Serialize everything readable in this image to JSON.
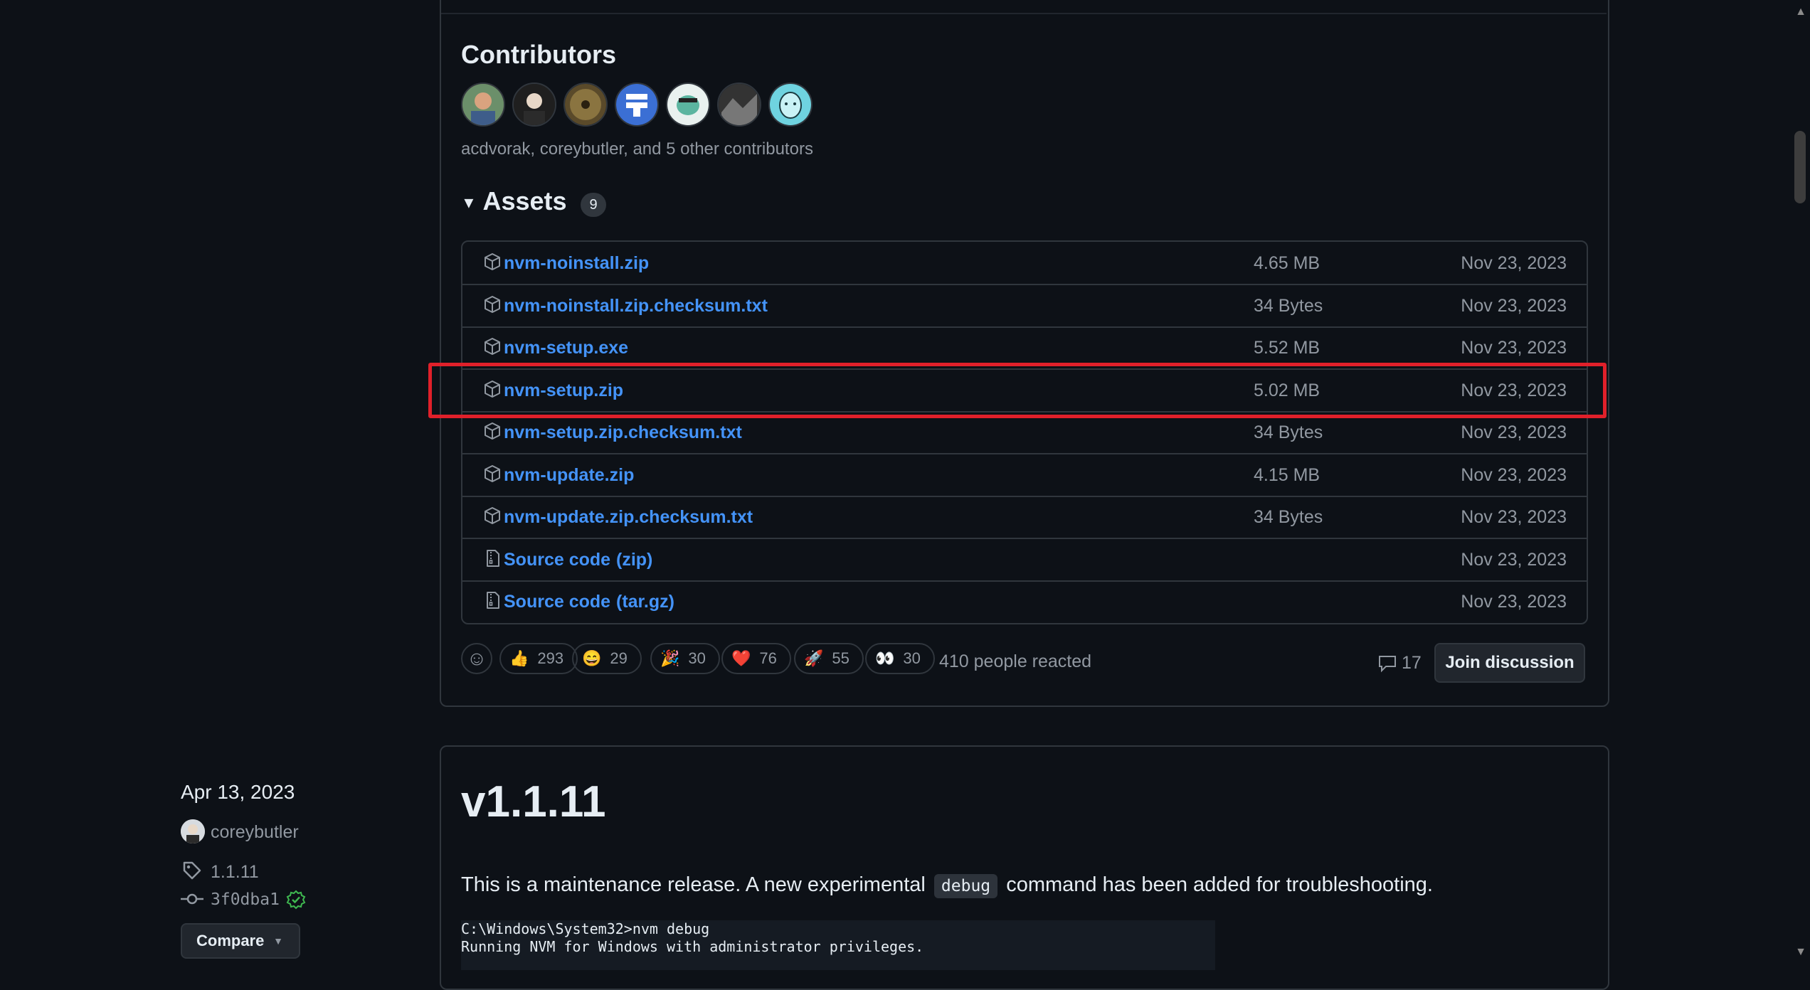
{
  "contributors": {
    "title": "Contributors",
    "summary": "acdvorak, coreybutler, and 5 other contributors",
    "avatars": [
      "avatar-1",
      "avatar-2",
      "avatar-3",
      "avatar-4",
      "avatar-5",
      "avatar-6",
      "avatar-7"
    ]
  },
  "assets": {
    "title": "Assets",
    "count": "9",
    "rows": [
      {
        "name": "nvm-noinstall.zip",
        "sub": "",
        "size": "4.65 MB",
        "date": "Nov 23, 2023",
        "icon": "package-icon"
      },
      {
        "name": "nvm-noinstall.zip.checksum.txt",
        "sub": "",
        "size": "34 Bytes",
        "date": "Nov 23, 2023",
        "icon": "package-icon"
      },
      {
        "name": "nvm-setup.exe",
        "sub": "",
        "size": "5.52 MB",
        "date": "Nov 23, 2023",
        "icon": "package-icon"
      },
      {
        "name": "nvm-setup.zip",
        "sub": "",
        "size": "5.02 MB",
        "date": "Nov 23, 2023",
        "icon": "package-icon"
      },
      {
        "name": "nvm-setup.zip.checksum.txt",
        "sub": "",
        "size": "34 Bytes",
        "date": "Nov 23, 2023",
        "icon": "package-icon"
      },
      {
        "name": "nvm-update.zip",
        "sub": "",
        "size": "4.15 MB",
        "date": "Nov 23, 2023",
        "icon": "package-icon"
      },
      {
        "name": "nvm-update.zip.checksum.txt",
        "sub": "",
        "size": "34 Bytes",
        "date": "Nov 23, 2023",
        "icon": "package-icon"
      },
      {
        "name": "Source code",
        "sub": "(zip)",
        "size": "",
        "date": "Nov 23, 2023",
        "icon": "file-zip-icon"
      },
      {
        "name": "Source code",
        "sub": "(tar.gz)",
        "size": "",
        "date": "Nov 23, 2023",
        "icon": "file-zip-icon"
      }
    ]
  },
  "reactions": {
    "items": [
      {
        "emoji": "👍",
        "count": "293"
      },
      {
        "emoji": "😄",
        "count": "29"
      },
      {
        "emoji": "🎉",
        "count": "30"
      },
      {
        "emoji": "❤️",
        "count": "76"
      },
      {
        "emoji": "🚀",
        "count": "55"
      },
      {
        "emoji": "👀",
        "count": "30"
      }
    ],
    "summary": "410 people reacted",
    "comments": "17",
    "join_label": "Join discussion"
  },
  "release2": {
    "date": "Apr 13, 2023",
    "author": "coreybutler",
    "tag": "1.1.11",
    "commit": "3f0dba1",
    "compare_label": "Compare",
    "version": "v1.1.11",
    "desc_before": "This is a maintenance release. A new experimental",
    "desc_code": "debug",
    "desc_after": "command has been added for troubleshooting.",
    "code_lines": "C:\\Windows\\System32>nvm debug\nRunning NVM for Windows with administrator privileges."
  },
  "colors": {
    "background": "#0d1117",
    "link": "#4493f8",
    "muted": "#9198a1",
    "highlight": "#e0202a",
    "verified": "#3fb950"
  }
}
